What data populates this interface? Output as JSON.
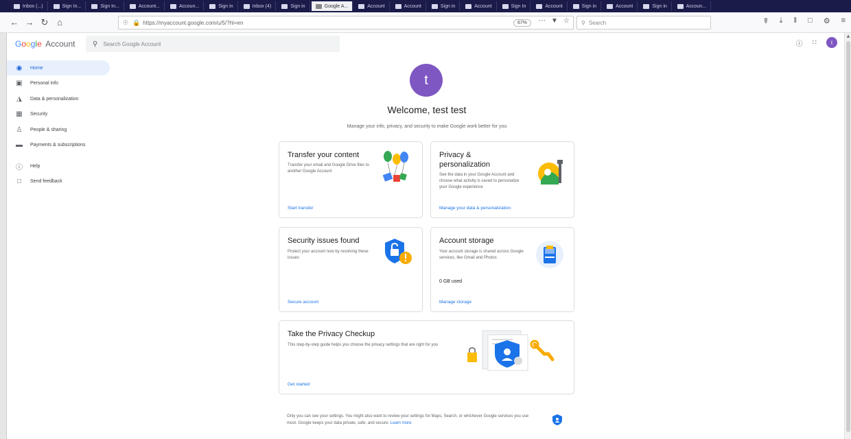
{
  "browser": {
    "tabs": [
      "Inbox (...)",
      "Sign In...",
      "Sign In...",
      "Account...",
      "Accoun...",
      "Sign in",
      "Inbox (4)",
      "Sign in",
      "Google A...",
      "Account",
      "Account",
      "Sign in",
      "Account",
      "Sign In",
      "Account",
      "Sign in",
      "Account",
      "Sign in",
      "Accoun..."
    ],
    "active_tab_index": 8,
    "url": "https://myaccount.google.com/u/5/?hl=en",
    "zoom": "67%",
    "search_placeholder": "Search"
  },
  "header": {
    "logo_google": [
      "G",
      "o",
      "o",
      "g",
      "l",
      "e"
    ],
    "logo_account": "Account",
    "search_placeholder": "Search Google Account",
    "avatar_letter": "t"
  },
  "sidebar": {
    "items": [
      {
        "label": "Home",
        "icon": "home-icon",
        "active": true
      },
      {
        "label": "Personal info",
        "icon": "id-card-icon",
        "active": false
      },
      {
        "label": "Data & personalization",
        "icon": "toggle-icon",
        "active": false
      },
      {
        "label": "Security",
        "icon": "lock-icon",
        "active": false
      },
      {
        "label": "People & sharing",
        "icon": "people-icon",
        "active": false
      },
      {
        "label": "Payments & subscriptions",
        "icon": "card-icon",
        "active": false
      }
    ],
    "secondary": [
      {
        "label": "Help",
        "icon": "help-icon"
      },
      {
        "label": "Send feedback",
        "icon": "feedback-icon"
      }
    ]
  },
  "main": {
    "avatar_letter": "t",
    "welcome": "Welcome, test test",
    "subtitle": "Manage your info, privacy, and security to make Google work better for you",
    "cards": {
      "transfer": {
        "title": "Transfer your content",
        "desc": "Transfer your email and Google Drive files to another Google Account",
        "link": "Start transfer"
      },
      "privacy": {
        "title": "Privacy & personalization",
        "desc": "See the data in your Google Account and choose what activity is saved to personalize your Google experience",
        "link": "Manage your data & personalization"
      },
      "security": {
        "title": "Security issues found",
        "desc": "Protect your account now by resolving these issues",
        "link": "Secure account"
      },
      "storage": {
        "title": "Account storage",
        "desc": "Your account storage is shared across Google services, like Gmail and Photos",
        "used": "0 GB used",
        "link": "Manage storage"
      },
      "checkup": {
        "title": "Take the Privacy Checkup",
        "desc": "This step-by-step guide helps you choose the privacy settings that are right for you",
        "link": "Get started"
      }
    },
    "footer": {
      "text": "Only you can see your settings. You might also want to review your settings for Maps, Search, or whichever Google services you use most. Google keeps your data private, safe, and secure.",
      "learn_more": "Learn more"
    }
  },
  "colors": {
    "accent": "#1a73e8",
    "avatar": "#7e57c2",
    "active_bg": "#e8f0fe"
  }
}
